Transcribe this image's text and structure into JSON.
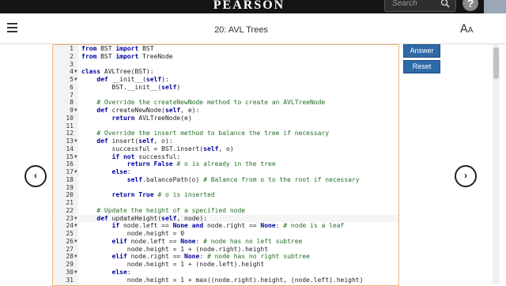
{
  "header": {
    "brand": "PEARSON",
    "search_placeholder": "Search",
    "help_label": "?"
  },
  "toolbar": {
    "title": "20: AVL Trees",
    "font_icon_glyph": "AA"
  },
  "buttons": {
    "answer": "Answer",
    "reset": "Reset"
  },
  "nav": {
    "prev_glyph": "‹",
    "next_glyph": "›"
  },
  "editor": {
    "active_line": 23,
    "lines": [
      {
        "n": "1",
        "fold": false,
        "segs": [
          {
            "c": "kw",
            "t": "from"
          },
          {
            "t": " BST "
          },
          {
            "c": "kw",
            "t": "import"
          },
          {
            "t": " BST"
          }
        ]
      },
      {
        "n": "2",
        "fold": false,
        "segs": [
          {
            "c": "kw",
            "t": "from"
          },
          {
            "t": " BST "
          },
          {
            "c": "kw",
            "t": "import"
          },
          {
            "t": " TreeNode"
          }
        ]
      },
      {
        "n": "3",
        "fold": false,
        "segs": []
      },
      {
        "n": "4",
        "fold": true,
        "segs": [
          {
            "c": "kw",
            "t": "class"
          },
          {
            "t": " AVLTree(BST):"
          }
        ]
      },
      {
        "n": "5",
        "fold": true,
        "segs": [
          {
            "t": "    "
          },
          {
            "c": "kw",
            "t": "def"
          },
          {
            "t": " __init__("
          },
          {
            "c": "kw",
            "t": "self"
          },
          {
            "t": "):"
          }
        ]
      },
      {
        "n": "6",
        "fold": false,
        "segs": [
          {
            "t": "        BST.__init__("
          },
          {
            "c": "kw",
            "t": "self"
          },
          {
            "t": ")"
          }
        ]
      },
      {
        "n": "7",
        "fold": false,
        "segs": []
      },
      {
        "n": "8",
        "fold": false,
        "segs": [
          {
            "c": "cm",
            "t": "    # Override the createNewNode method to create an AVLTreeNode"
          }
        ]
      },
      {
        "n": "9",
        "fold": true,
        "segs": [
          {
            "t": "    "
          },
          {
            "c": "kw",
            "t": "def"
          },
          {
            "t": " createNewNode("
          },
          {
            "c": "kw",
            "t": "self"
          },
          {
            "t": ", e):"
          }
        ]
      },
      {
        "n": "10",
        "fold": false,
        "segs": [
          {
            "t": "        "
          },
          {
            "c": "kw",
            "t": "return"
          },
          {
            "t": " AVLTreeNode(e)"
          }
        ]
      },
      {
        "n": "11",
        "fold": false,
        "segs": []
      },
      {
        "n": "12",
        "fold": false,
        "segs": [
          {
            "c": "cm",
            "t": "    # Override the insert method to balance the tree if necessary"
          }
        ]
      },
      {
        "n": "13",
        "fold": true,
        "segs": [
          {
            "t": "    "
          },
          {
            "c": "kw",
            "t": "def"
          },
          {
            "t": " insert("
          },
          {
            "c": "kw",
            "t": "self"
          },
          {
            "t": ", o):"
          }
        ]
      },
      {
        "n": "14",
        "fold": false,
        "segs": [
          {
            "t": "        successful = BST.insert("
          },
          {
            "c": "kw",
            "t": "self"
          },
          {
            "t": ", o)"
          }
        ]
      },
      {
        "n": "15",
        "fold": true,
        "segs": [
          {
            "t": "        "
          },
          {
            "c": "kw",
            "t": "if not"
          },
          {
            "t": " successful:"
          }
        ]
      },
      {
        "n": "16",
        "fold": false,
        "segs": [
          {
            "t": "            "
          },
          {
            "c": "kw",
            "t": "return False"
          },
          {
            "t": " "
          },
          {
            "c": "cm",
            "t": "# o is already in the tree"
          }
        ]
      },
      {
        "n": "17",
        "fold": true,
        "segs": [
          {
            "t": "        "
          },
          {
            "c": "kw",
            "t": "else"
          },
          {
            "t": ":"
          }
        ]
      },
      {
        "n": "18",
        "fold": false,
        "segs": [
          {
            "t": "            "
          },
          {
            "c": "kw",
            "t": "self"
          },
          {
            "t": ".balancePath(o) "
          },
          {
            "c": "cm",
            "t": "# Balance from o to the root if necessary"
          }
        ]
      },
      {
        "n": "19",
        "fold": false,
        "segs": []
      },
      {
        "n": "20",
        "fold": false,
        "segs": [
          {
            "t": "        "
          },
          {
            "c": "kw",
            "t": "return True"
          },
          {
            "t": " "
          },
          {
            "c": "cm",
            "t": "# o is inserted"
          }
        ]
      },
      {
        "n": "21",
        "fold": false,
        "segs": []
      },
      {
        "n": "22",
        "fold": false,
        "segs": [
          {
            "c": "cm",
            "t": "    # Update the height of a specified node"
          }
        ]
      },
      {
        "n": "23",
        "fold": true,
        "segs": [
          {
            "t": "    "
          },
          {
            "c": "kw",
            "t": "def"
          },
          {
            "t": " updateHeight("
          },
          {
            "c": "kw",
            "t": "self"
          },
          {
            "t": ", node):"
          }
        ]
      },
      {
        "n": "24",
        "fold": true,
        "segs": [
          {
            "t": "        "
          },
          {
            "c": "kw",
            "t": "if"
          },
          {
            "t": " node.left == "
          },
          {
            "c": "kw",
            "t": "None and"
          },
          {
            "t": " node.right == "
          },
          {
            "c": "kw",
            "t": "None"
          },
          {
            "t": ": "
          },
          {
            "c": "cm",
            "t": "# node is a leaf"
          }
        ]
      },
      {
        "n": "25",
        "fold": false,
        "segs": [
          {
            "t": "            node.height = 0"
          }
        ]
      },
      {
        "n": "26",
        "fold": true,
        "segs": [
          {
            "t": "        "
          },
          {
            "c": "kw",
            "t": "elif"
          },
          {
            "t": " node.left == "
          },
          {
            "c": "kw",
            "t": "None"
          },
          {
            "t": ": "
          },
          {
            "c": "cm",
            "t": "# node has no left subtree"
          }
        ]
      },
      {
        "n": "27",
        "fold": false,
        "segs": [
          {
            "t": "            node.height = 1 + (node.right).height"
          }
        ]
      },
      {
        "n": "28",
        "fold": true,
        "segs": [
          {
            "t": "        "
          },
          {
            "c": "kw",
            "t": "elif"
          },
          {
            "t": " node.right == "
          },
          {
            "c": "kw",
            "t": "None"
          },
          {
            "t": ": "
          },
          {
            "c": "cm",
            "t": "# node has no right subtree"
          }
        ]
      },
      {
        "n": "29",
        "fold": false,
        "segs": [
          {
            "t": "            node.height = 1 + (node.left).height"
          }
        ]
      },
      {
        "n": "30",
        "fold": true,
        "segs": [
          {
            "t": "        "
          },
          {
            "c": "kw",
            "t": "else"
          },
          {
            "t": ":"
          }
        ]
      },
      {
        "n": "31",
        "fold": false,
        "segs": [
          {
            "t": "            node.height = 1 + max((node.right).height, (node.left).height)"
          }
        ]
      }
    ]
  },
  "colors": {
    "topbar": "#151515",
    "button": "#2f6aa8",
    "editor_border": "#f0b37e",
    "keyword": "#0000a0",
    "comment": "#236e25"
  },
  "icons": [
    "search-icon",
    "help-icon",
    "menu-icon",
    "font-size-icon",
    "chevron-left-icon",
    "chevron-right-icon"
  ]
}
